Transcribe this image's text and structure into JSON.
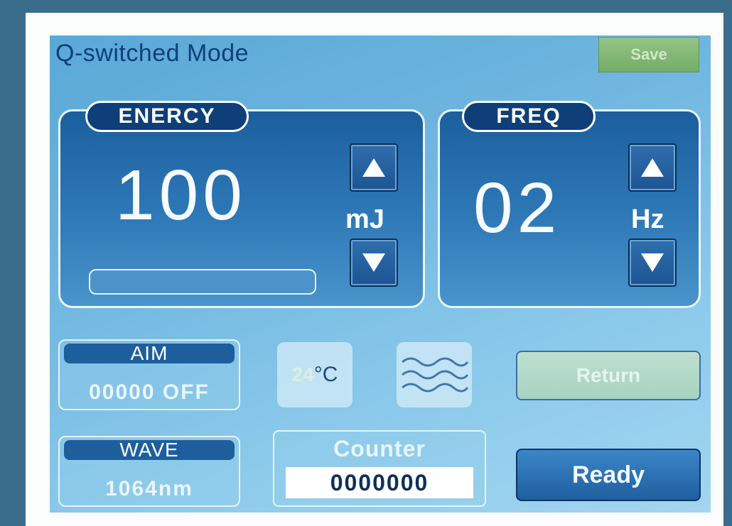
{
  "screen": {
    "title": "Q-switched Mode",
    "save_label": "Save"
  },
  "energy": {
    "label": "ENERCY",
    "value": "100",
    "unit": "mJ",
    "level": 0.0,
    "up_icon": "triangle-up-icon",
    "down_icon": "triangle-down-icon"
  },
  "freq": {
    "label": "FREQ",
    "value": "02",
    "unit": "Hz",
    "up_icon": "triangle-up-icon",
    "down_icon": "triangle-down-icon"
  },
  "aim": {
    "label": "AIM",
    "value": "00000 OFF"
  },
  "wave": {
    "label": "WAVE",
    "value": "1064nm"
  },
  "temperature": {
    "value": "24",
    "unit": "°C"
  },
  "water_flow": {
    "icon": "water-wave-icon"
  },
  "counter": {
    "label": "Counter",
    "value": "0000000"
  },
  "buttons": {
    "return_label": "Return",
    "ready_label": "Ready"
  },
  "colors": {
    "background": "#3a6d8b",
    "screen": "#6fb6e0",
    "panel": "#1b5f9d",
    "title_text": "#0e3f7a",
    "save_button": "#74ad66",
    "ready_button": "#1f5f9f"
  }
}
